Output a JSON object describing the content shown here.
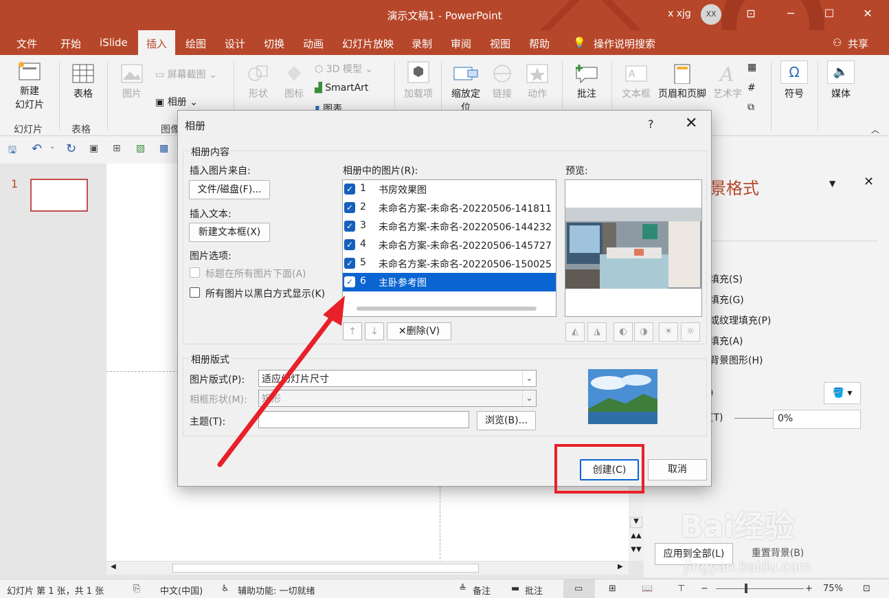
{
  "window": {
    "title": "演示文稿1 - PowerPoint",
    "user_name": "x xjg",
    "avatar_initials": "XX"
  },
  "tabs": [
    "文件",
    "开始",
    "iSlide",
    "插入",
    "绘图",
    "设计",
    "切换",
    "动画",
    "幻灯片放映",
    "录制",
    "审阅",
    "视图",
    "帮助"
  ],
  "active_tab": "插入",
  "tell_me": "操作说明搜索",
  "share": "共享",
  "ribbon": {
    "new_slide": "新建\n幻灯片",
    "group_slides": "幻灯片",
    "table": "表格",
    "group_table": "表格",
    "pictures": "图片",
    "screenshot": "屏幕截图",
    "album": "相册",
    "group_images": "图像",
    "shapes": "形状",
    "icons": "图标",
    "model_3d": "3D 模型",
    "smartart": "SmartArt",
    "chart": "图表",
    "addins": "加载项",
    "zoom": "缩放定位",
    "link": "链接",
    "action": "动作",
    "comment": "批注",
    "textbox": "文本框",
    "header_footer": "页眉和页脚",
    "wordart": "艺术字",
    "symbols": "符号",
    "media": "媒体"
  },
  "thumbnail_number": "1",
  "format_pane": {
    "title": "景格式",
    "options": [
      "填充(S)",
      "填充(G)",
      "或纹理填充(P)",
      "填充(A)",
      "背景图形(H)"
    ],
    "transparency_value": "0%",
    "label_t": "(T)",
    "apply_all": "应用到全部(L)",
    "reset_bg": "重置背景(B)"
  },
  "status": {
    "slide_info": "幻灯片 第 1 张，共 1 张",
    "language": "中文(中国)",
    "accessibility": "辅助功能: 一切就绪",
    "notes": "备注",
    "comments": "批注",
    "zoom": "75%"
  },
  "dialog": {
    "title": "相册",
    "help": "?",
    "section_content": "相册内容",
    "insert_from": "插入图片来自:",
    "file_disk_button": "文件/磁盘(F)...",
    "insert_text": "插入文本:",
    "new_textbox_button": "新建文本框(X)",
    "picture_options": "图片选项:",
    "caption_below": "标题在所有图片下面(A)",
    "black_white": "所有图片以黑白方式显示(K)",
    "pictures_in_album": "相册中的图片(R):",
    "preview_label": "预览:",
    "items": [
      {
        "num": "1",
        "name": "书房效果图"
      },
      {
        "num": "2",
        "name": "未命名方案-未命名-20220506-141811"
      },
      {
        "num": "3",
        "name": "未命名方案-未命名-20220506-144232"
      },
      {
        "num": "4",
        "name": "未命名方案-未命名-20220506-145727"
      },
      {
        "num": "5",
        "name": "未命名方案-未命名-20220506-150025"
      },
      {
        "num": "6",
        "name": "主卧参考图"
      }
    ],
    "selected_index": 6,
    "delete_button": "删除(V)",
    "section_layout": "相册版式",
    "picture_layout_label": "图片版式(P):",
    "picture_layout_value": "适应幻灯片尺寸",
    "frame_shape_label": "相框形状(M):",
    "frame_shape_value": "矩形",
    "theme_label": "主题(T):",
    "theme_value": "",
    "browse_button": "浏览(B)...",
    "create_button": "创建(C)",
    "cancel_button": "取消"
  },
  "watermark": {
    "brand": "Bai经验",
    "url": "jingyan.baidu.com"
  },
  "colors": {
    "accent": "#b7472a",
    "selection": "#0a64d2",
    "annotation": "#e8202a"
  }
}
